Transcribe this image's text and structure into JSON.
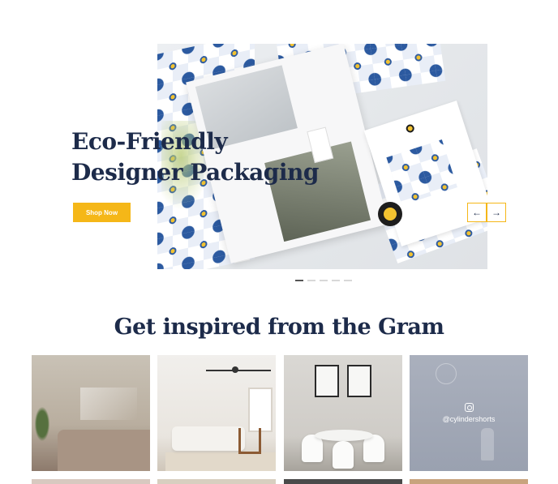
{
  "hero": {
    "title_line1": "Eco-Friendly",
    "title_line2": "Designer Packaging",
    "cta_label": "Shop Now",
    "prev_arrow": "←",
    "next_arrow": "→",
    "slide_count": 5,
    "active_slide": 1
  },
  "gram": {
    "title": "Get inspired from the Gram",
    "hover_handle": "@cylindershorts",
    "icon": "instagram-icon"
  },
  "colors": {
    "accent": "#f5b718",
    "heading": "#1d2b4a"
  }
}
